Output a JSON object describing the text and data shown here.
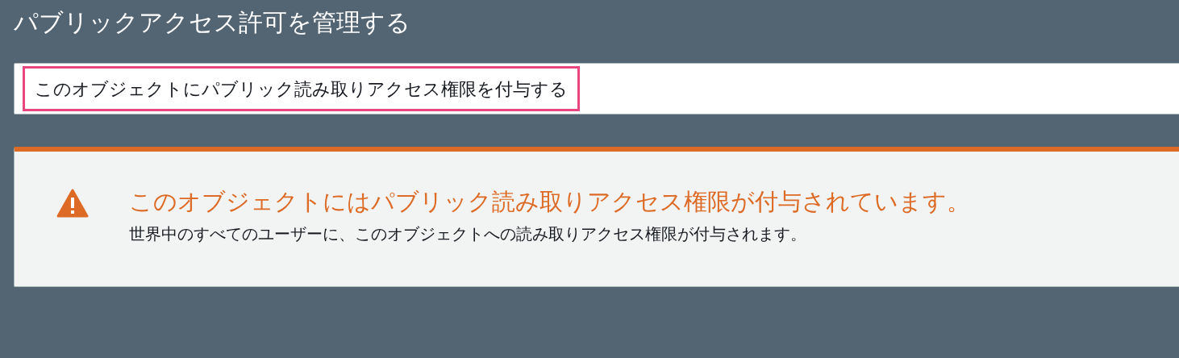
{
  "title": "パブリックアクセス許可を管理する",
  "select": {
    "value": "このオブジェクトにパブリック読み取りアクセス権限を付与する",
    "highlighted": true
  },
  "alert": {
    "kind": "warning",
    "heading": "このオブジェクトにはパブリック読み取りアクセス権限が付与されています。",
    "body": "世界中のすべてのユーザーに、このオブジェクトへの読み取りアクセス権限が付与されます。"
  }
}
